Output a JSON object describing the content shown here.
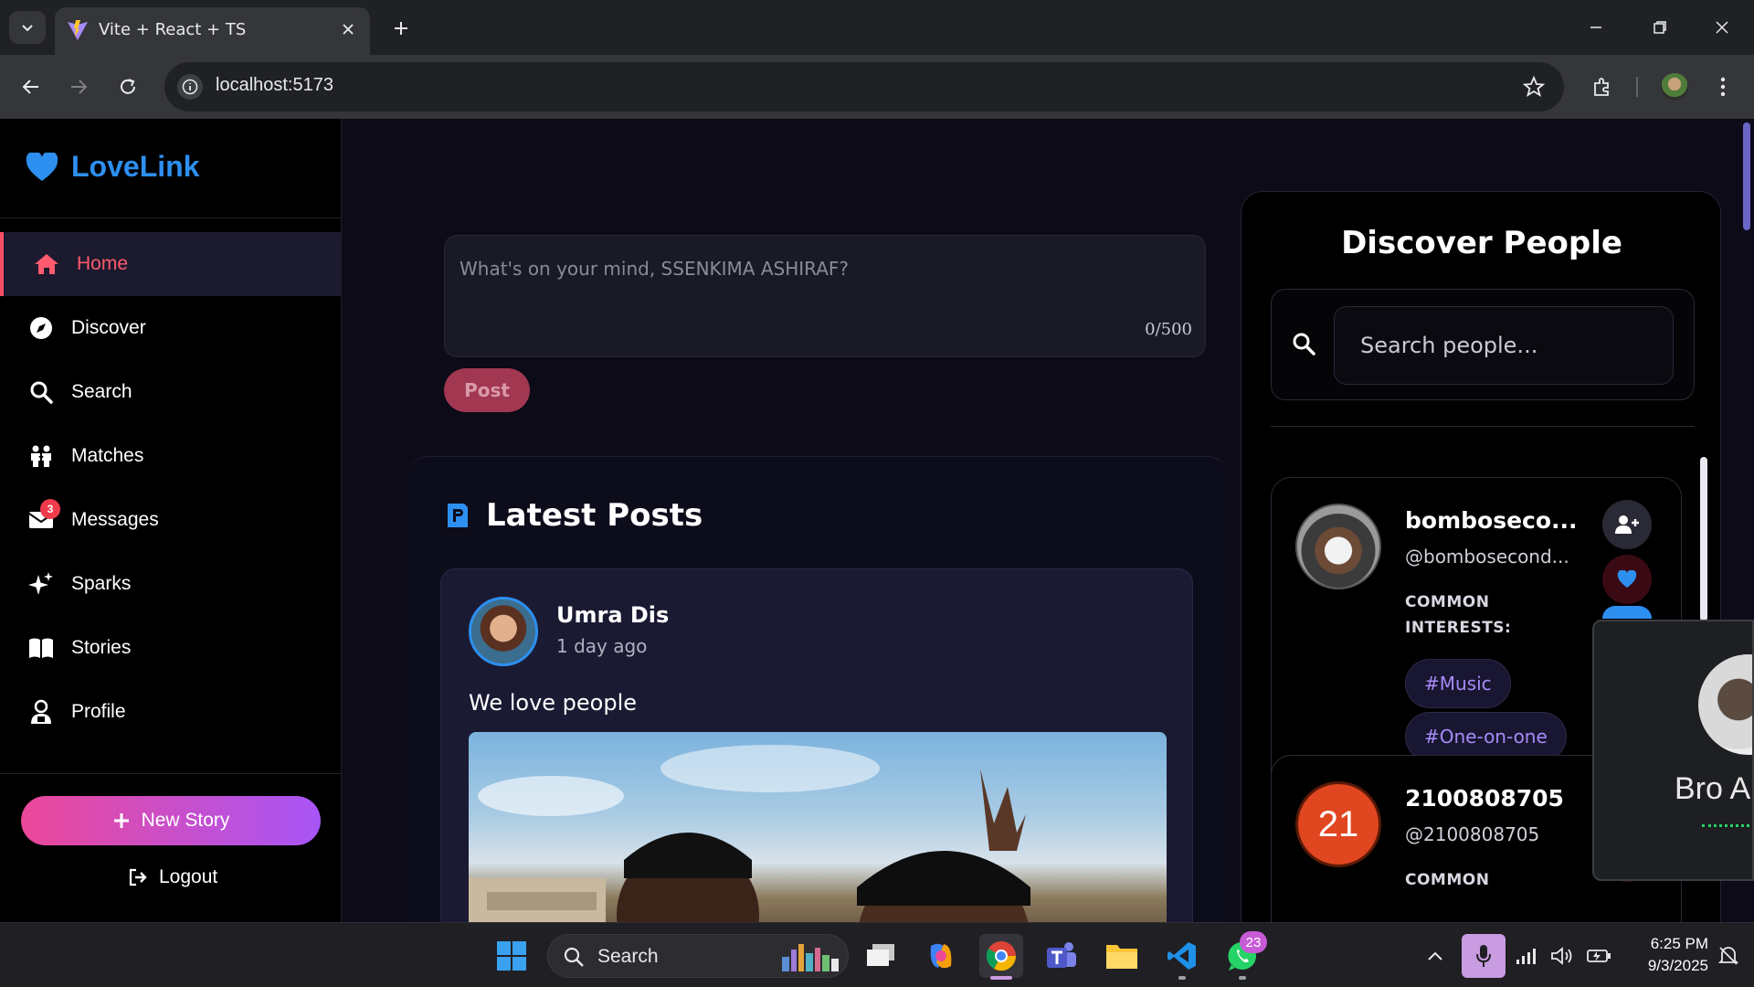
{
  "browser": {
    "tab_title": "Vite + React + TS",
    "url": "localhost:5173"
  },
  "app": {
    "brand": "LoveLink",
    "nav": [
      {
        "label": "Home",
        "icon": "home-icon",
        "active": true
      },
      {
        "label": "Discover",
        "icon": "compass-icon"
      },
      {
        "label": "Search",
        "icon": "search-icon"
      },
      {
        "label": "Matches",
        "icon": "people-icon"
      },
      {
        "label": "Messages",
        "icon": "envelope-icon",
        "badge": "3"
      },
      {
        "label": "Sparks",
        "icon": "sparkle-icon"
      },
      {
        "label": "Stories",
        "icon": "book-icon"
      },
      {
        "label": "Profile",
        "icon": "user-icon"
      }
    ],
    "new_story_label": "New Story",
    "logout_label": "Logout",
    "accent": "#2d8ff0",
    "active_color": "#ff5a6e"
  },
  "composer": {
    "placeholder": "What's on your mind, SSENKIMA ASHIRAF?",
    "counter": "0/500",
    "post_label": "Post"
  },
  "feed": {
    "title": "Latest Posts",
    "posts": [
      {
        "user": "Umra Dis",
        "time": "1 day ago",
        "text": "We love people"
      }
    ]
  },
  "discover": {
    "title": "Discover People",
    "search_placeholder": "Search people...",
    "people": [
      {
        "name": "bomboseco...",
        "handle": "@bombosecond...",
        "common_label": "COMMON INTERESTS:",
        "tags": [
          "#Music",
          "#One-on-one"
        ]
      },
      {
        "name": "2100808705",
        "handle": "@2100808705",
        "initials": "21",
        "common_label": "COMMON"
      }
    ]
  },
  "call_window": {
    "name": "Bro A"
  },
  "taskbar": {
    "search_label": "Search",
    "whatsapp_badge": "23",
    "time": "6:25 PM",
    "date": "9/3/2025"
  }
}
